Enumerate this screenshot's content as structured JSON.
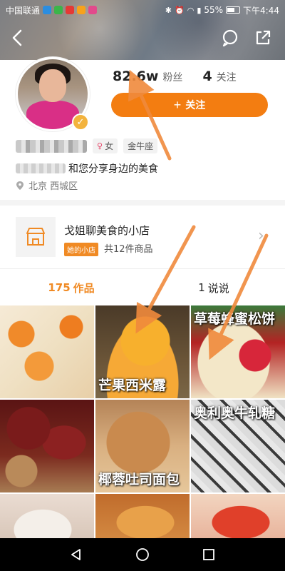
{
  "status_bar": {
    "carrier": "中国联通",
    "battery": "55%",
    "time": "下午4:44"
  },
  "nav": {
    "back_icon": "back-arrow-icon",
    "chat_icon": "chat-bubble-icon",
    "share_icon": "share-icon"
  },
  "profile": {
    "fans_count": "82.6w",
    "fans_label": "粉丝",
    "follow_count": "4",
    "follow_label": "关注",
    "follow_button": "关注",
    "gender": "女",
    "zodiac": "金牛座",
    "bio": "和您分享身边的美食",
    "location": "北京 西城区",
    "colors": {
      "accent": "#f37d11"
    }
  },
  "shop": {
    "name": "戈姐聊美食的小店",
    "badge": "她的小店",
    "count": "共12件商品",
    "icon": "shop-icon"
  },
  "tabs": [
    {
      "count": "175",
      "label": "作品",
      "active": true
    },
    {
      "count": "1",
      "label": "说说",
      "active": false
    }
  ],
  "grid": [
    {
      "title": ""
    },
    {
      "title": "芒果西米露"
    },
    {
      "title": "草莓蜂蜜松饼"
    },
    {
      "title": ""
    },
    {
      "title": "椰蓉吐司面包"
    },
    {
      "title": "奥利奥牛轧糖"
    },
    {
      "title": ""
    },
    {
      "title": ""
    },
    {
      "title": ""
    }
  ]
}
